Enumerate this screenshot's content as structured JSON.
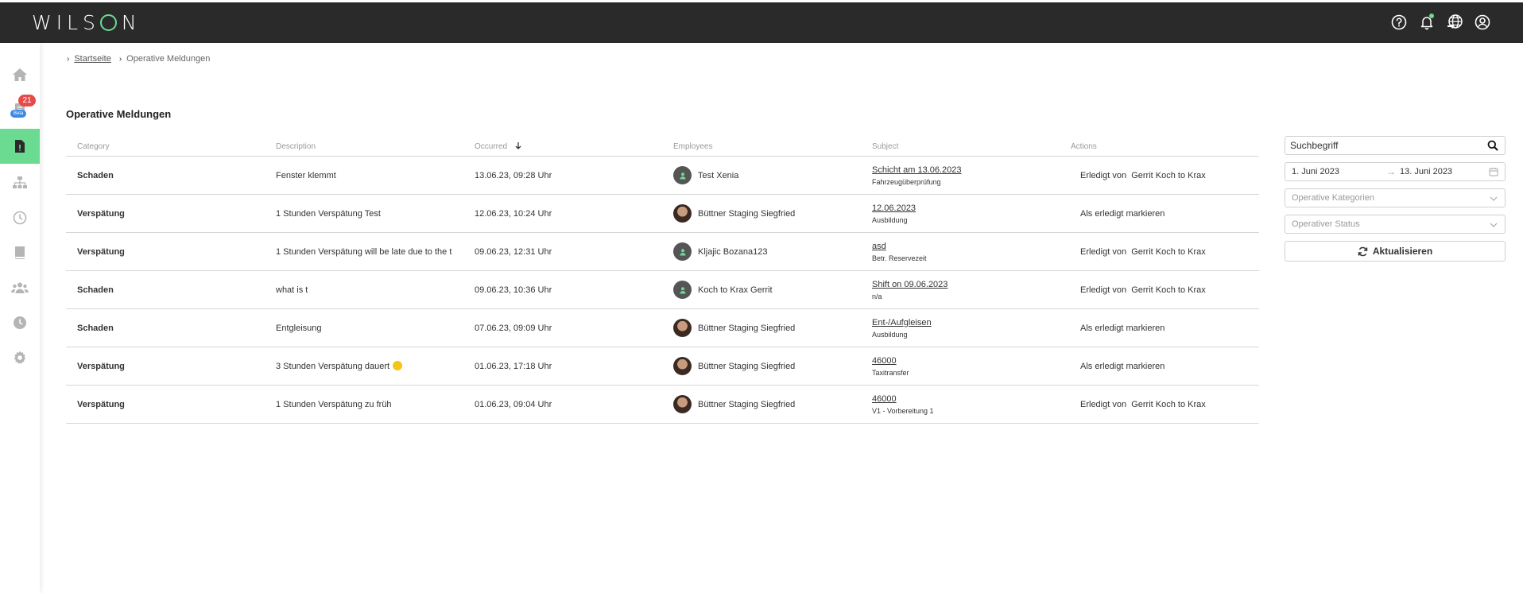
{
  "app": {
    "logo": "WILSON"
  },
  "topbar": {
    "help": "help-icon",
    "notifications": "bell-icon",
    "language": "globe-chat-icon",
    "account": "user-circle-icon"
  },
  "sidebar": {
    "items": [
      {
        "name": "home",
        "icon": "home-icon"
      },
      {
        "name": "messages",
        "icon": "document-icon",
        "badge": "21",
        "tag": "Beta"
      },
      {
        "name": "operative-meldungen",
        "icon": "report-icon",
        "active": true
      },
      {
        "name": "structure",
        "icon": "hierarchy-icon"
      },
      {
        "name": "time",
        "icon": "clock-icon"
      },
      {
        "name": "book",
        "icon": "book-icon"
      },
      {
        "name": "team",
        "icon": "users-icon"
      },
      {
        "name": "history",
        "icon": "clock-filled-icon"
      },
      {
        "name": "settings",
        "icon": "gear-icon"
      }
    ]
  },
  "breadcrumb": {
    "home": "Startseite",
    "current": "Operative Meldungen"
  },
  "page": {
    "title": "Operative Meldungen"
  },
  "table": {
    "headers": {
      "category": "Category",
      "description": "Description",
      "occurred": "Occurred",
      "employees": "Employees",
      "subject": "Subject",
      "actions": "Actions"
    },
    "rows": [
      {
        "category": "Schaden",
        "description": "Fenster klemmt",
        "occurred": "13.06.23, 09:28 Uhr",
        "employee": "Test Xenia",
        "avatar": "placeholder",
        "subject": "Schicht am 13.06.2023",
        "subject_sub": "Fahrzeugüberprüfung",
        "action": "Erledigt von  Gerrit Koch to Krax"
      },
      {
        "category": "Verspätung",
        "description": "1 Stunden Verspätung Test",
        "occurred": "12.06.23, 10:24 Uhr",
        "employee": "Büttner Staging Siegfried",
        "avatar": "photo",
        "subject": "12.06.2023",
        "subject_sub": "Ausbildung",
        "action": "Als erledigt markieren"
      },
      {
        "category": "Verspätung",
        "description": "1 Stunden Verspätung will be late due to the t",
        "occurred": "09.06.23, 12:31 Uhr",
        "employee": "Kljajic Bozana123",
        "avatar": "placeholder",
        "subject": "asd",
        "subject_sub": "Betr. Reservezeit",
        "action": "Erledigt von  Gerrit Koch to Krax"
      },
      {
        "category": "Schaden",
        "description": "what is t",
        "occurred": "09.06.23, 10:36 Uhr",
        "employee": "Koch to Krax Gerrit",
        "avatar": "placeholder",
        "subject": "Shift on 09.06.2023",
        "subject_sub": "n/a",
        "action": "Erledigt von  Gerrit Koch to Krax"
      },
      {
        "category": "Schaden",
        "description": "Entgleisung",
        "occurred": "07.06.23, 09:09 Uhr",
        "employee": "Büttner Staging Siegfried",
        "avatar": "photo",
        "subject": "Ent-/Aufgleisen",
        "subject_sub": "Ausbildung",
        "action": "Als erledigt markieren"
      },
      {
        "category": "Verspätung",
        "description": "3 Stunden Verspätung dauert",
        "emoji": true,
        "occurred": "01.06.23, 17:18 Uhr",
        "employee": "Büttner Staging Siegfried",
        "avatar": "photo",
        "subject": "46000",
        "subject_sub": "Taxitransfer",
        "action": "Als erledigt markieren"
      },
      {
        "category": "Verspätung",
        "description": "1 Stunden Verspätung zu früh",
        "occurred": "01.06.23, 09:04 Uhr",
        "employee": "Büttner Staging Siegfried",
        "avatar": "photo",
        "subject": "46000",
        "subject_sub": "V1 - Vorbereitung 1",
        "action": "Erledigt von  Gerrit Koch to Krax"
      }
    ]
  },
  "filters": {
    "search_placeholder": "Suchbegriff",
    "date_from": "1. Juni 2023",
    "date_arrow": "→",
    "date_to": "13. Juni 2023",
    "category_placeholder": "Operative Kategorien",
    "status_placeholder": "Operativer Status",
    "refresh_label": "Aktualisieren"
  },
  "colors": {
    "accent": "#6cdb92",
    "topbar": "#2a2a2a",
    "badge": "#e74a4a",
    "beta": "#3b8be6"
  }
}
